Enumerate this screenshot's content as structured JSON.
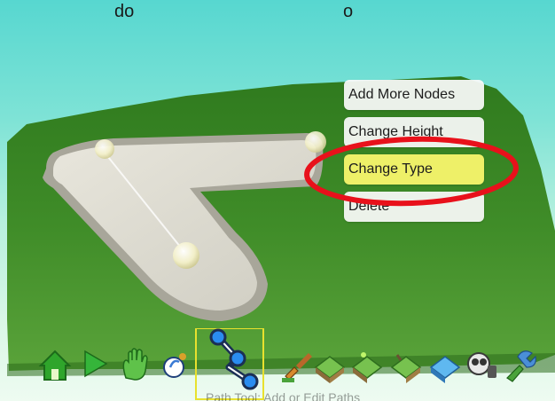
{
  "header": {
    "left_fragment": "do",
    "right_fragment": "o"
  },
  "context_menu": {
    "items": [
      {
        "label": "Add More Nodes"
      },
      {
        "label": "Change Height"
      },
      {
        "label": "Change Type"
      },
      {
        "label": "Delete"
      }
    ],
    "highlighted_index": 2
  },
  "toolbar": {
    "active_tool_label": "Path Tool: Add or Edit Paths",
    "tools": [
      {
        "icon": "home-icon"
      },
      {
        "icon": "play-icon"
      },
      {
        "icon": "hand-icon"
      },
      {
        "icon": "node-tool-icon"
      },
      {
        "icon": "path-tool-icon"
      },
      {
        "icon": "paint-brush-icon"
      },
      {
        "icon": "terrain-raise-icon"
      },
      {
        "icon": "terrain-lower-icon"
      },
      {
        "icon": "terrain-smooth-icon"
      },
      {
        "icon": "water-icon"
      },
      {
        "icon": "camera-icon"
      },
      {
        "icon": "object-tool-icon"
      }
    ]
  },
  "colors": {
    "highlight_ring": "#e8111b",
    "selected_item": "#eef068",
    "grass": "#3f8a27",
    "path": "#d8d6cc"
  }
}
